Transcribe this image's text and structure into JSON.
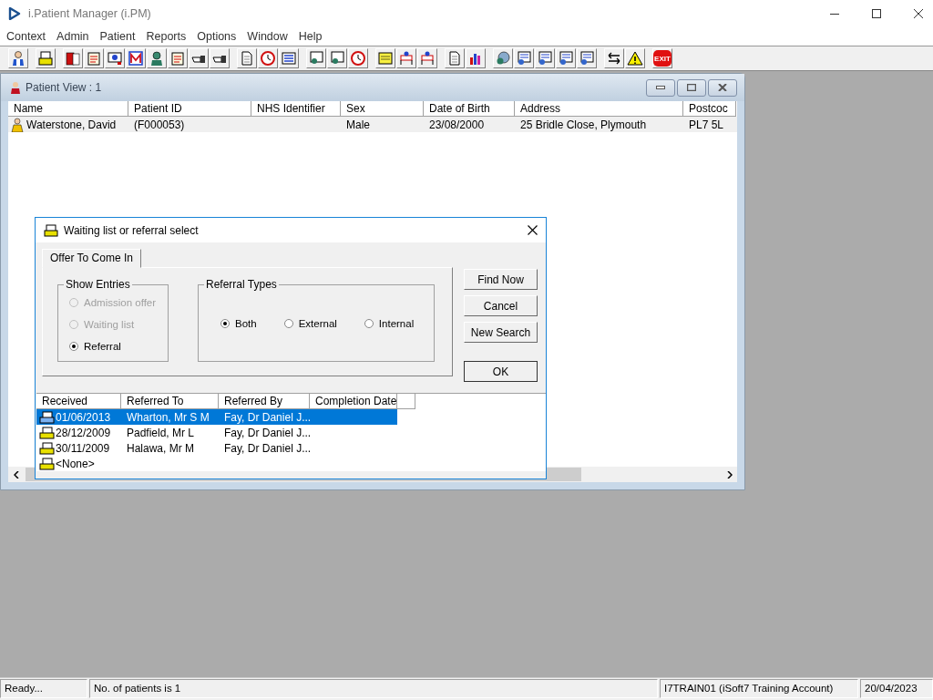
{
  "app": {
    "title": "i.Patient Manager (i.PM)"
  },
  "menu": [
    "Context",
    "Admin",
    "Patient",
    "Reports",
    "Options",
    "Window",
    "Help"
  ],
  "toolbar": {
    "exit_label": "EXIT"
  },
  "patient_view": {
    "title": "Patient View : 1",
    "columns": [
      "Name",
      "Patient ID",
      "NHS Identifier",
      "Sex",
      "Date of Birth",
      "Address",
      "Postcoc"
    ],
    "rows": [
      {
        "cells": [
          "Waterstone, David",
          "(F000053)",
          "",
          "Male",
          "23/08/2000",
          "25 Bridle Close, Plymouth",
          "PL7 5L"
        ]
      }
    ]
  },
  "dialog": {
    "title": "Waiting list or referral select",
    "tabs": [
      {
        "label": "Offer To Come In",
        "selected": true
      }
    ],
    "show_entries": {
      "label": "Show Entries",
      "options": [
        {
          "label": "Admission offer",
          "selected": false,
          "disabled": true
        },
        {
          "label": "Waiting list",
          "selected": false,
          "disabled": true
        },
        {
          "label": "Referral",
          "selected": true,
          "disabled": false
        }
      ]
    },
    "referral_types": {
      "label": "Referral Types",
      "options": [
        {
          "label": "Both",
          "selected": true,
          "disabled": false
        },
        {
          "label": "External",
          "selected": false,
          "disabled": false
        },
        {
          "label": "Internal",
          "selected": false,
          "disabled": false
        }
      ]
    },
    "buttons": [
      "Find Now",
      "Cancel",
      "New Search",
      "OK"
    ],
    "columns": [
      "Received",
      "Referred To",
      "Referred By",
      "Completion Date"
    ],
    "rows": [
      {
        "cells": [
          "01/06/2013",
          "Wharton, Mr S M",
          "Fay, Dr Daniel J...",
          ""
        ],
        "selected": true
      },
      {
        "cells": [
          "28/12/2009",
          "Padfield, Mr L",
          "Fay, Dr Daniel J...",
          ""
        ],
        "selected": false
      },
      {
        "cells": [
          "30/11/2009",
          "Halawa, Mr M",
          "Fay, Dr Daniel J...",
          ""
        ],
        "selected": false
      },
      {
        "cells": [
          "<None>",
          "",
          "",
          ""
        ],
        "selected": false
      }
    ]
  },
  "status_bar": [
    "Ready...",
    "No. of patients is 1",
    "I7TRAIN01 (iSoft7 Training Account)",
    "20/04/2023"
  ]
}
